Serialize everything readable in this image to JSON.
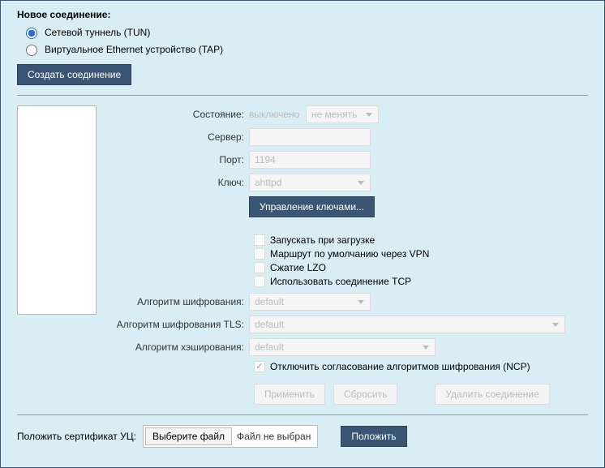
{
  "heading": "Новое соединение:",
  "radios": {
    "tun": "Сетевой туннель (TUN)",
    "tap": "Виртуальное Ethernet устройство (TAP)"
  },
  "create_btn": "Создать соединение",
  "form": {
    "state_label": "Состояние:",
    "state_value": "выключено",
    "state_select": "не менять",
    "server_label": "Сервер:",
    "server_value": "",
    "port_label": "Порт:",
    "port_value": "1194",
    "key_label": "Ключ:",
    "key_value": "ahttpd",
    "manage_keys_btn": "Управление ключами...",
    "chk_boot": "Запускать при загрузке",
    "chk_route": "Маршрут по умолчанию через VPN",
    "chk_lzo": "Сжатие LZO",
    "chk_tcp": "Использовать соединение TCP",
    "cipher_label": "Алгоритм шифрования:",
    "cipher_value": "default",
    "tls_label": "Алгоритм шифрования TLS:",
    "tls_value": "default",
    "hash_label": "Алгоритм хэширования:",
    "hash_value": "default",
    "ncp_label": "Отключить согласование алгоритмов шифрования (NCP)",
    "apply_btn": "Применить",
    "reset_btn": "Сбросить",
    "delete_btn": "Удалить соединение"
  },
  "bottom": {
    "upload_label": "Положить сертификат УЦ:",
    "choose_btn": "Выберите файл",
    "no_file": "Файл не выбран",
    "submit_btn": "Положить"
  }
}
